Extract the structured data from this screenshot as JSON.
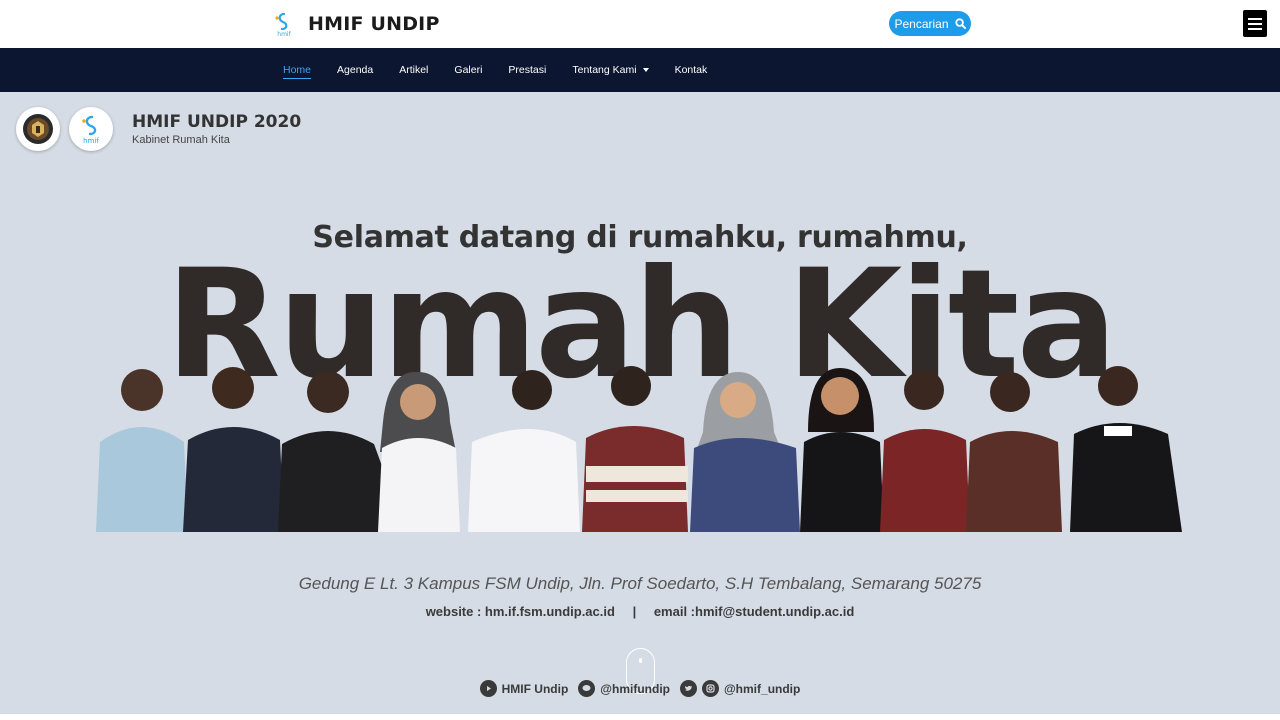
{
  "header": {
    "brand_title": "HMIF UNDIP",
    "brand_logo_text": "hmif",
    "search_label": "Pencarian",
    "accent_color": "#1e9be9"
  },
  "nav": {
    "items": [
      {
        "label": "Home",
        "active": true
      },
      {
        "label": "Agenda"
      },
      {
        "label": "Artikel"
      },
      {
        "label": "Galeri"
      },
      {
        "label": "Prestasi"
      },
      {
        "label": "Tentang Kami",
        "dropdown": true
      },
      {
        "label": "Kontak"
      }
    ],
    "background": "#0c1630"
  },
  "hero": {
    "title": "HMIF UNDIP 2020",
    "subtitle": "Kabinet Rumah Kita",
    "welcome": "Selamat datang di rumahku, rumahmu,",
    "headline": "Rumah Kita",
    "address": "Gedung E Lt. 3 Kampus FSM Undip, Jln. Prof Soedarto, S.H Tembalang, Semarang 50275",
    "website": "website : hm.if.fsm.undip.ac.id",
    "separator": "|",
    "email": "email :hmif@student.undip.ac.id",
    "background": "#d5dce5"
  },
  "socials": {
    "youtube": "HMIF Undip",
    "line": "@hmifundip",
    "twitter_instagram": "@hmif_undip"
  }
}
